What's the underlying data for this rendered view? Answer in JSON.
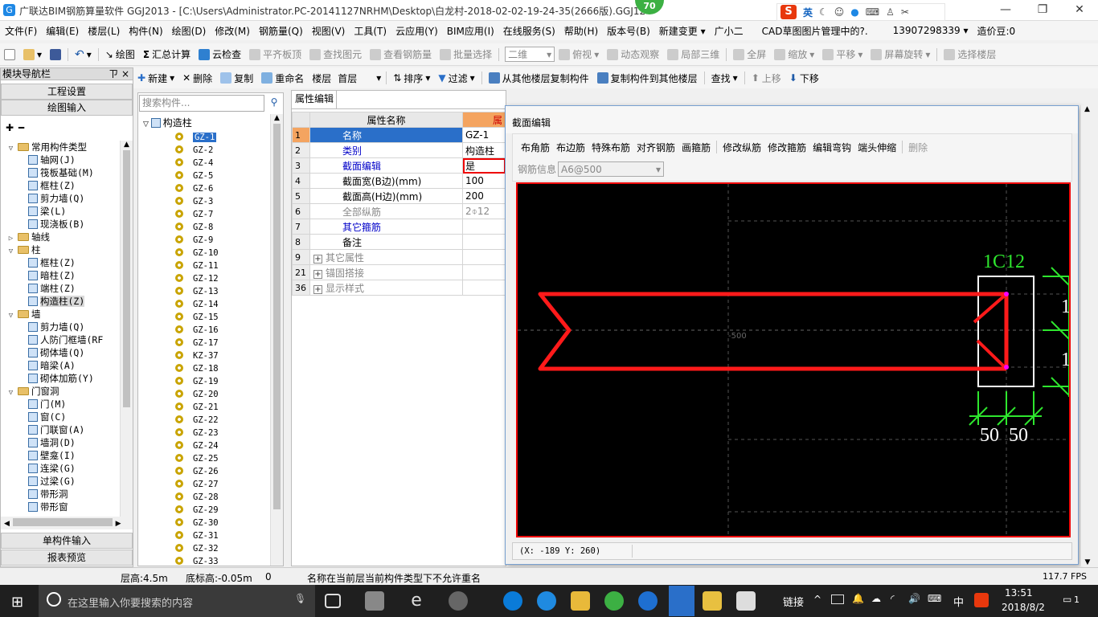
{
  "title_bar": {
    "title": "广联达BIM钢筋算量软件 GGJ2013 - [C:\\Users\\Administrator.PC-20141127NRHM\\Desktop\\白龙村-2018-02-02-19-24-35(2666版).GGJ12",
    "badge": "70",
    "ime": {
      "lang_label": "英",
      "logo": "S"
    }
  },
  "menu": [
    "文件(F)",
    "编辑(E)",
    "楼层(L)",
    "构件(N)",
    "绘图(D)",
    "修改(M)",
    "钢筋量(Q)",
    "视图(V)",
    "工具(T)",
    "云应用(Y)",
    "BIM应用(I)",
    "在线服务(S)",
    "帮助(H)",
    "版本号(B)",
    "新建变更 ▾",
    "广小二",
    "CAD草图图片管理中的?.",
    "13907298339 ▾",
    "造价豆:0"
  ],
  "toolbar1": {
    "draw": "绘图",
    "sum": "汇总计算",
    "cloud_check": "云检查",
    "flat_top": "平齐板顶",
    "find_elem": "查找图元",
    "view_rebar": "查看钢筋量",
    "batch_select": "批量选择",
    "view_mode": "二维",
    "top_view": "俯视",
    "dynamic": "动态观察",
    "local3d": "局部三维",
    "fullscreen": "全屏",
    "zoom": "缩放",
    "pan": "平移",
    "rotate": "屏幕旋转",
    "select_layer": "选择楼层"
  },
  "toolbar2": {
    "new": "新建",
    "delete": "删除",
    "copy": "复制",
    "rename": "重命名",
    "floor_label": "楼层",
    "floor_value": "首层",
    "sort": "排序",
    "filter": "过滤",
    "copy_from": "从其他楼层复制构件",
    "copy_to": "复制构件到其他楼层",
    "find": "查找",
    "move_up": "上移",
    "move_down": "下移"
  },
  "nav": {
    "header": "模块导航栏",
    "pin": "ㄗ ×",
    "project_settings": "工程设置",
    "drawing_input": "绘图输入",
    "tree": [
      {
        "level": 0,
        "type": "folder",
        "label": "常用构件类型",
        "exp": "▽"
      },
      {
        "level": 1,
        "type": "item",
        "label": "轴网(J)"
      },
      {
        "level": 1,
        "type": "item",
        "label": "筏板基础(M)"
      },
      {
        "level": 1,
        "type": "item",
        "label": "框柱(Z)"
      },
      {
        "level": 1,
        "type": "item",
        "label": "剪力墙(Q)"
      },
      {
        "level": 1,
        "type": "item",
        "label": "梁(L)"
      },
      {
        "level": 1,
        "type": "item",
        "label": "现浇板(B)"
      },
      {
        "level": 0,
        "type": "folder",
        "label": "轴线",
        "exp": "▷"
      },
      {
        "level": 0,
        "type": "folder",
        "label": "柱",
        "exp": "▽"
      },
      {
        "level": 1,
        "type": "item",
        "label": "框柱(Z)"
      },
      {
        "level": 1,
        "type": "item",
        "label": "暗柱(Z)"
      },
      {
        "level": 1,
        "type": "item",
        "label": "端柱(Z)"
      },
      {
        "level": 1,
        "type": "item",
        "label": "构造柱(Z)",
        "selected": true
      },
      {
        "level": 0,
        "type": "folder",
        "label": "墙",
        "exp": "▽"
      },
      {
        "level": 1,
        "type": "item",
        "label": "剪力墙(Q)"
      },
      {
        "level": 1,
        "type": "item",
        "label": "人防门框墙(RF"
      },
      {
        "level": 1,
        "type": "item",
        "label": "砌体墙(Q)"
      },
      {
        "level": 1,
        "type": "item",
        "label": "暗梁(A)"
      },
      {
        "level": 1,
        "type": "item",
        "label": "砌体加筋(Y)"
      },
      {
        "level": 0,
        "type": "folder",
        "label": "门窗洞",
        "exp": "▽"
      },
      {
        "level": 1,
        "type": "item",
        "label": "门(M)"
      },
      {
        "level": 1,
        "type": "item",
        "label": "窗(C)"
      },
      {
        "level": 1,
        "type": "item",
        "label": "门联窗(A)"
      },
      {
        "level": 1,
        "type": "item",
        "label": "墙洞(D)"
      },
      {
        "level": 1,
        "type": "item",
        "label": "壁龛(I)"
      },
      {
        "level": 1,
        "type": "item",
        "label": "连梁(G)"
      },
      {
        "level": 1,
        "type": "item",
        "label": "过梁(G)"
      },
      {
        "level": 1,
        "type": "item",
        "label": "带形洞"
      },
      {
        "level": 1,
        "type": "item",
        "label": "带形窗"
      }
    ],
    "single_input": "单构件输入",
    "report_preview": "报表预览"
  },
  "component_list": {
    "search_placeholder": "搜索构件...",
    "root": "构造柱",
    "items": [
      "GZ-1",
      "GZ-2",
      "GZ-4",
      "GZ-5",
      "GZ-6",
      "GZ-3",
      "GZ-7",
      "GZ-8",
      "GZ-9",
      "GZ-10",
      "GZ-11",
      "GZ-12",
      "GZ-13",
      "GZ-14",
      "GZ-15",
      "GZ-16",
      "GZ-17",
      "KZ-37",
      "GZ-18",
      "GZ-19",
      "GZ-20",
      "GZ-21",
      "GZ-22",
      "GZ-23",
      "GZ-24",
      "GZ-25",
      "GZ-26",
      "GZ-27",
      "GZ-28",
      "GZ-29",
      "GZ-30",
      "GZ-31",
      "GZ-32",
      "GZ-33"
    ],
    "selected": "GZ-1"
  },
  "properties": {
    "tab": "属性编辑",
    "col_name": "属性名称",
    "col_value": "属",
    "rows": [
      {
        "num": "1",
        "name": "名称",
        "value": "GZ-1",
        "style": "blue",
        "selected": true
      },
      {
        "num": "2",
        "name": "类别",
        "value": "构造柱",
        "style": "blue"
      },
      {
        "num": "3",
        "name": "截面编辑",
        "value": "是",
        "style": "blue",
        "highlight": true
      },
      {
        "num": "4",
        "name": "截面宽(B边)(mm)",
        "value": "100",
        "style": "normal"
      },
      {
        "num": "5",
        "name": "截面高(H边)(mm)",
        "value": "200",
        "style": "normal"
      },
      {
        "num": "6",
        "name": "全部纵筋",
        "value": "2⌽12",
        "style": "grey"
      },
      {
        "num": "7",
        "name": "其它箍筋",
        "value": "",
        "style": "blue"
      },
      {
        "num": "8",
        "name": "备注",
        "value": "",
        "style": "normal"
      },
      {
        "num": "9",
        "name": "其它属性",
        "value": "",
        "style": "grey",
        "expand": "+"
      },
      {
        "num": "21",
        "name": "锚固搭接",
        "value": "",
        "style": "grey",
        "expand": "+"
      },
      {
        "num": "36",
        "name": "显示样式",
        "value": "",
        "style": "grey",
        "expand": "+"
      }
    ]
  },
  "section_dialog": {
    "title": "截面编辑",
    "tools": [
      "布角筋",
      "布边筋",
      "特殊布筋",
      "对齐钢筋",
      "画箍筋",
      "修改纵筋",
      "修改箍筋",
      "编辑弯钩",
      "端头伸缩",
      "删除"
    ],
    "rebar_info_label": "钢筋信息",
    "rebar_info_value": "A6@500",
    "rebar_label": "1C12",
    "dim_50_left": "50",
    "dim_50_right": "50",
    "dim_right_a": "1",
    "dim_right_b": "1",
    "axis_label": "-500",
    "coords": "(X: -189 Y: 260)"
  },
  "status": {
    "floor_height": "层高:4.5m",
    "base_height": "底标高:-0.05m",
    "zero": "0",
    "message": "名称在当前层当前构件类型下不允许重名",
    "fps": "117.7 FPS"
  },
  "taskbar": {
    "search_placeholder": "在这里输入你要搜索的内容",
    "link": "链接",
    "ime": "中",
    "time": "13:51",
    "date": "2018/8/2",
    "notif": "1"
  }
}
